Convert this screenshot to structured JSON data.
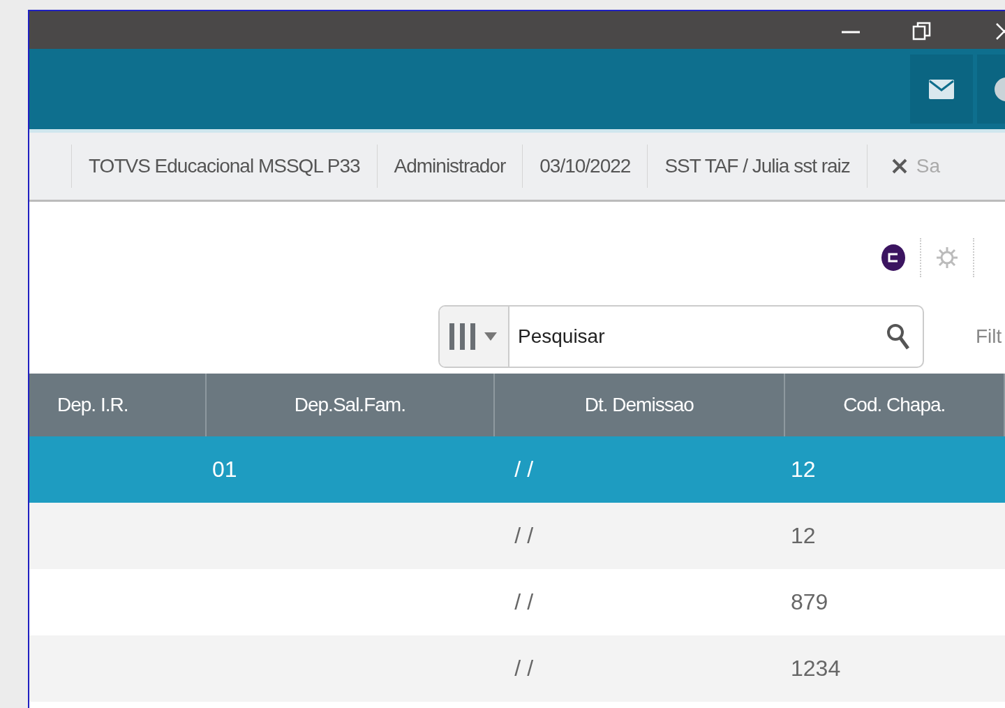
{
  "info_bar": {
    "items": [
      "TOTVS Educacional MSSQL P33",
      "Administrador",
      "03/10/2022",
      "SST TAF / Julia sst raiz"
    ],
    "exit_label": "Sa"
  },
  "search": {
    "placeholder": "Pesquisar"
  },
  "filter_label": "Filt",
  "table": {
    "columns": [
      "Dep. I.R.",
      "Dep.Sal.Fam.",
      "Dt. Demissao",
      "Cod. Chapa."
    ],
    "rows": [
      {
        "selected": true,
        "dep_sal_fam": "01",
        "dt_demissao": "/ /",
        "cod_chapa": "12"
      },
      {
        "selected": false,
        "dt_demissao": "/ /",
        "cod_chapa": "12"
      },
      {
        "selected": false,
        "dt_demissao": "/ /",
        "cod_chapa": "879"
      },
      {
        "selected": false,
        "dt_demissao": "/ /",
        "cod_chapa": "1234"
      }
    ]
  }
}
